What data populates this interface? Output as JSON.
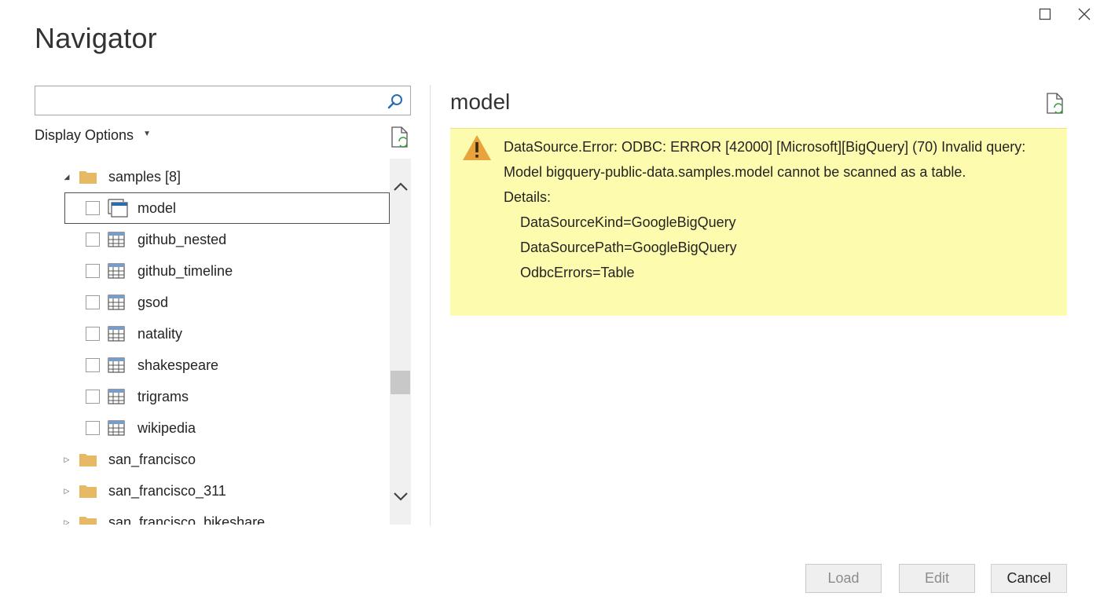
{
  "window": {
    "title": "Navigator",
    "maximize_icon": "maximize-icon",
    "close_icon": "close-icon"
  },
  "search": {
    "value": "",
    "placeholder": "",
    "icon": "search-icon"
  },
  "display_options": {
    "label": "Display Options",
    "icon": "chevron-down-icon"
  },
  "tree": {
    "items": [
      {
        "label": "samples [8]",
        "type": "folder",
        "expanded": true
      },
      {
        "label": "model",
        "type": "model",
        "checked": false,
        "selected": true
      },
      {
        "label": "github_nested",
        "type": "table",
        "checked": false
      },
      {
        "label": "github_timeline",
        "type": "table",
        "checked": false
      },
      {
        "label": "gsod",
        "type": "table",
        "checked": false
      },
      {
        "label": "natality",
        "type": "table",
        "checked": false
      },
      {
        "label": "shakespeare",
        "type": "table",
        "checked": false
      },
      {
        "label": "trigrams",
        "type": "table",
        "checked": false
      },
      {
        "label": "wikipedia",
        "type": "table",
        "checked": false
      },
      {
        "label": "san_francisco",
        "type": "folder",
        "expanded": false
      },
      {
        "label": "san_francisco_311",
        "type": "folder",
        "expanded": false
      },
      {
        "label": "san_francisco_bikeshare",
        "type": "folder",
        "expanded": false
      }
    ]
  },
  "preview": {
    "title": "model",
    "error": {
      "line1": "DataSource.Error: ODBC: ERROR [42000] [Microsoft][BigQuery] (70) Invalid query:",
      "line2": "Model bigquery-public-data.samples.model cannot be scanned as a table.",
      "details_label": "Details:",
      "detail1": "DataSourceKind=GoogleBigQuery",
      "detail2": "DataSourcePath=GoogleBigQuery",
      "detail3": "OdbcErrors=Table"
    }
  },
  "footer": {
    "load_label": "Load",
    "edit_label": "Edit",
    "cancel_label": "Cancel"
  },
  "colors": {
    "error_background": "#fdfbae",
    "folder": "#e8b964",
    "warning": "#e8a33d"
  }
}
